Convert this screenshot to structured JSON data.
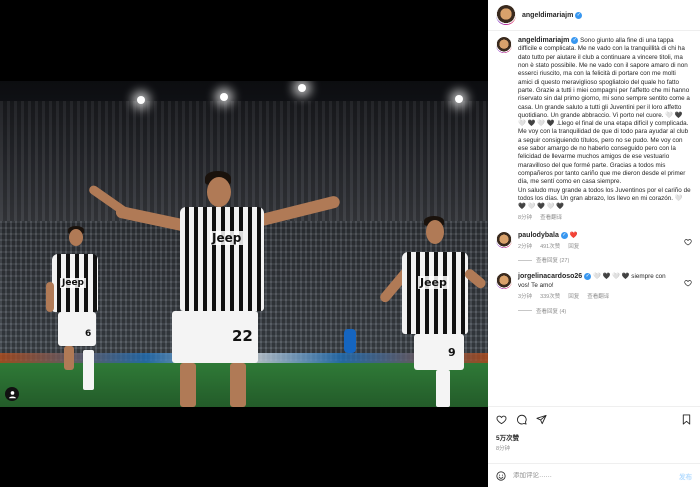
{
  "post": {
    "author": "angeldimariajm",
    "caption_paragraphs": [
      "Sono giunto alla fine di una tappa difficile e complicata. Me ne vado con la tranquillità di chi ha dato tutto per aiutare il club a continuare a vincere titoli, ma non è stato possibile. Me ne vado con il sapore amaro di non esserci riuscito, ma con la felicità di portare con me molti amici di questo meraviglioso spogliatoio del quale ho fatto parte. Grazie a tutti i miei compagni per l'affetto che mi hanno riservato sin dal primo giorno, mi sono sempre sentito come a casa. Un grande saluto a tutti gli Juventini per il loro affetto quotidiano. Un grande abbraccio. Vi porto nel cuore. 🤍 🖤 🤍 🖤 🤍 🖤 .Llego el final de una etapa difícil y complicada. Me voy con la tranquilidad de que di todo para ayudar al club a seguir consiguiendo títulos, pero no se pudo. Me voy con ese sabor amargo de no haberlo conseguido pero con la felicidad de llevarme muchos amigos de ese vestuario maravilloso del que formé parte. Gracias a todos mis compañeros por tanto cariño que me dieron desde el primer día, me sentí como en casa siempre.",
      "Un saludo muy grande a todos los Juventinos por el cariño de todos los días. Un gran abrazo, los llevo en mi corazón. 🤍 🖤 🤍 🖤 🤍 🖤"
    ],
    "caption_time": "8分钟",
    "caption_translate": "查看翻译",
    "likes": "5万次赞",
    "time": "8分钟",
    "comment_placeholder": "添加评论……",
    "post_label": "发布"
  },
  "comments": [
    {
      "user": "paulodybala",
      "text": "❤️",
      "time": "2分钟",
      "likes": "491次赞",
      "reply_label": "回复",
      "replies_label": "查看回复 (27)"
    },
    {
      "user": "jorgelinacardoso26",
      "text": "🤍 🖤 🤍 🖤 siempre con vos! Te amo!",
      "time": "3分钟",
      "likes": "339次赞",
      "reply_label": "回复",
      "translate_label": "查看翻译",
      "replies_label": "查看回复 (4)"
    }
  ],
  "players": {
    "main_number": "22",
    "left_number": "6",
    "right_number": "9",
    "sponsor": "Jeep"
  },
  "colors": {
    "verified": "#3897f0",
    "heart": "#ed4956",
    "muted": "#8e8e8e",
    "post_button": "#b3dbff"
  },
  "icons": {
    "like": "heart-outline-icon",
    "comment": "comment-icon",
    "share": "share-icon",
    "save": "bookmark-icon",
    "emoji": "emoji-icon",
    "tagged": "user-tag-icon"
  }
}
